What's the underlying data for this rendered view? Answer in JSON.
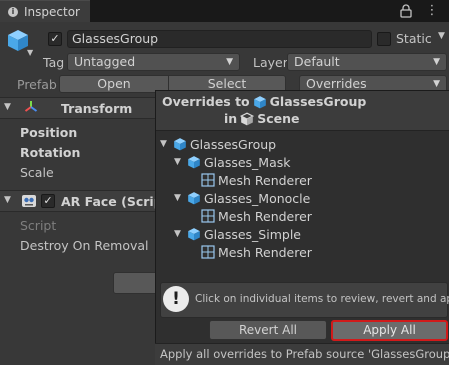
{
  "window": {
    "tab_title": "Inspector"
  },
  "gameobject": {
    "name": "GlassesGroup",
    "static_label": "Static",
    "tag_label": "Tag",
    "tag_value": "Untagged",
    "layer_label": "Layer",
    "layer_value": "Default"
  },
  "prefab": {
    "label": "Prefab",
    "open_label": "Open",
    "select_label": "Select",
    "overrides_label": "Overrides"
  },
  "transform": {
    "title": "Transform",
    "position_label": "Position",
    "rotation_label": "Rotation",
    "scale_label": "Scale"
  },
  "arface": {
    "title": "AR Face (Script",
    "script_label": "Script",
    "destroy_label": "Destroy On Removal"
  },
  "popup": {
    "title_prefix": "Overrides to",
    "title_target": "GlassesGroup",
    "title_in": "in",
    "title_scene": "Scene",
    "tree": [
      {
        "label": "GlassesGroup",
        "level": 0,
        "icon": "prefab-cube-icon"
      },
      {
        "label": "Glasses_Mask",
        "level": 1,
        "icon": "prefab-cube-icon"
      },
      {
        "label": "Mesh Renderer",
        "level": 2,
        "icon": "mesh-renderer-icon"
      },
      {
        "label": "Glasses_Monocle",
        "level": 1,
        "icon": "prefab-cube-icon"
      },
      {
        "label": "Mesh Renderer",
        "level": 2,
        "icon": "mesh-renderer-icon"
      },
      {
        "label": "Glasses_Simple",
        "level": 1,
        "icon": "prefab-cube-icon"
      },
      {
        "label": "Mesh Renderer",
        "level": 2,
        "icon": "mesh-renderer-icon"
      }
    ],
    "info_text": "Click on individual items to review, revert and apply.",
    "revert_label": "Revert All",
    "apply_label": "Apply All",
    "status_text": "Apply all overrides to Prefab source 'GlassesGroup'."
  },
  "colors": {
    "prefab_blue": "#4aa8e8",
    "highlight_red": "#d11a1a"
  }
}
